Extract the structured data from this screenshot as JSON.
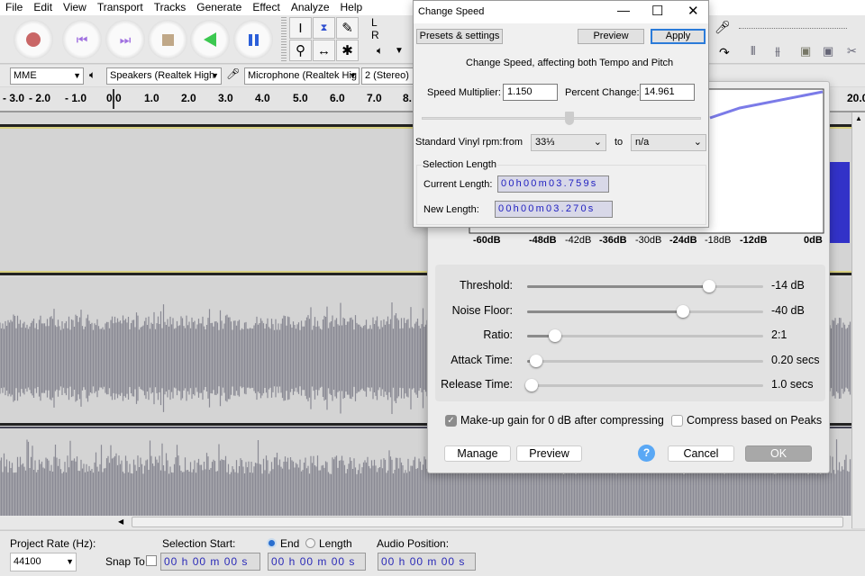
{
  "menu": [
    "File",
    "Edit",
    "View",
    "Transport",
    "Tracks",
    "Generate",
    "Effect",
    "Analyze",
    "Help"
  ],
  "transport": {
    "record": "record-icon",
    "skip_start": "skip-to-start-icon",
    "skip_end": "skip-to-end-icon",
    "stop": "stop-icon",
    "play": "play-icon",
    "pause": "pause-icon"
  },
  "meter": {
    "left": "L",
    "right": "R"
  },
  "devices": {
    "host": "MME",
    "output": "Speakers (Realtek High",
    "input": "Microphone (Realtek Hig",
    "channels": "2 (Stereo) In"
  },
  "ruler": [
    "- 3.0",
    "- 2.0",
    "- 1.0",
    "0.0",
    "1.0",
    "2.0",
    "3.0",
    "4.0",
    "5.0",
    "6.0",
    "7.0",
    "8.",
    "20.0"
  ],
  "change_speed": {
    "title": "Change Speed",
    "presets_label": "Presets & settings",
    "preview_label": "Preview",
    "apply_label": "Apply",
    "description": "Change Speed, affecting both Tempo and Pitch",
    "speed_multiplier_label": "Speed Multiplier:",
    "speed_multiplier": "1.150",
    "percent_change_label": "Percent Change:",
    "percent_change": "14.961",
    "vinyl_label": "Standard Vinyl rpm:",
    "from_label": "from",
    "from_value": "33⅓",
    "to_label": "to",
    "to_value": "n/a",
    "selection_group": "Selection Length",
    "current_length_label": "Current Length:",
    "current_length": "00h00m03.759s",
    "new_length_label": "New Length:",
    "new_length": "00h00m03.270s"
  },
  "compressor": {
    "axis_labels": [
      "-60dB",
      "-48dB",
      "-42dB",
      "-36dB",
      "-30dB",
      "-24dB",
      "-18dB",
      "-12dB",
      "0dB"
    ],
    "sliders": [
      {
        "label": "Threshold:",
        "value": "-14 dB",
        "fraction": 0.77
      },
      {
        "label": "Noise Floor:",
        "value": "-40 dB",
        "fraction": 0.66
      },
      {
        "label": "Ratio:",
        "value": "2:1",
        "fraction": 0.12
      },
      {
        "label": "Attack Time:",
        "value": "0.20 secs",
        "fraction": 0.04
      },
      {
        "label": "Release Time:",
        "value": "1.0 secs",
        "fraction": 0.02
      }
    ],
    "makeup_label": "Make-up gain for 0 dB after compressing",
    "makeup_checked": true,
    "peaks_label": "Compress based on Peaks",
    "peaks_checked": false,
    "manage_label": "Manage",
    "preview_label": "Preview",
    "help_label": "?",
    "cancel_label": "Cancel",
    "ok_label": "OK"
  },
  "bottom": {
    "rate_label": "Project Rate (Hz):",
    "rate": "44100",
    "snap_label": "Snap To",
    "sel_start_label": "Selection Start:",
    "end_label": "End",
    "length_label": "Length",
    "audio_pos_label": "Audio Position:",
    "sel_start": "00 h 00 m 00 s",
    "sel_end": "00 h 00 m 00 s",
    "audio_pos": "00 h 00 m 00 s"
  },
  "colors": {
    "accent": "#2b5fd9",
    "waveform": "#8a8a94",
    "selected_wave": "#3232c8"
  }
}
